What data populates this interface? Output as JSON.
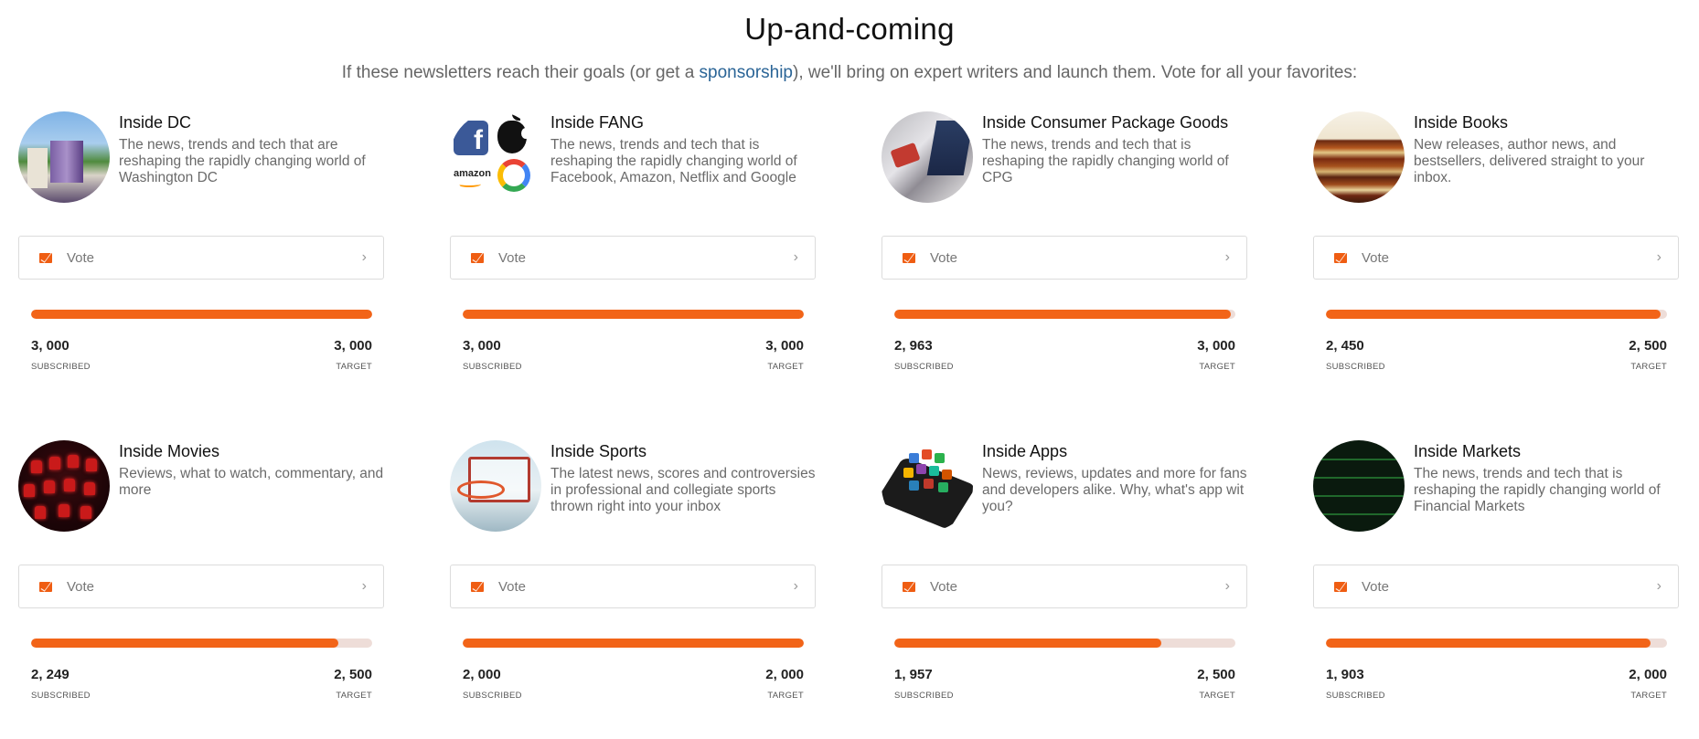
{
  "header": {
    "title": "Up-and-coming",
    "subtitle_before": "If these newsletters reach their goals (or get a ",
    "subtitle_link": "sponsorship",
    "subtitle_after": "), we'll bring on expert writers and launch them. Vote for all your favorites:"
  },
  "common": {
    "vote_label": "Vote",
    "subscribed_caption": "SUBSCRIBED",
    "target_caption": "TARGET",
    "accent_color": "#f26418",
    "link_color": "#2a6496"
  },
  "cards": [
    {
      "name": "Inside DC",
      "desc": "The news, trends and tech that are reshaping the rapidly changing world of Washington DC",
      "subscribed": "3, 000",
      "target": "3, 000",
      "progress": 1.0
    },
    {
      "name": "Inside FANG",
      "desc": "The news, trends and tech that is reshaping the rapidly changing world of Facebook, Amazon, Netflix and Google",
      "subscribed": "3, 000",
      "target": "3, 000",
      "progress": 1.0
    },
    {
      "name": "Inside Consumer Package Goods",
      "desc": "The news, trends and tech that is reshaping the rapidly changing world of CPG",
      "subscribed": "2, 963",
      "target": "3, 000",
      "progress": 0.9877
    },
    {
      "name": "Inside Books",
      "desc": "New releases, author news, and bestsellers, delivered straight to your inbox.",
      "subscribed": "2, 450",
      "target": "2, 500",
      "progress": 0.98
    },
    {
      "name": "Inside Movies",
      "desc": "Reviews, what to watch, commentary, and more",
      "subscribed": "2, 249",
      "target": "2, 500",
      "progress": 0.8996
    },
    {
      "name": "Inside Sports",
      "desc": "The latest news, scores and controversies in professional and collegiate sports thrown right into your inbox",
      "subscribed": "2, 000",
      "target": "2, 000",
      "progress": 1.0
    },
    {
      "name": "Inside Apps",
      "desc": "News, reviews, updates and more for fans and developers alike. Why, what's app wit you?",
      "subscribed": "1, 957",
      "target": "2, 500",
      "progress": 0.7828
    },
    {
      "name": "Inside Markets",
      "desc": "The news, trends and tech that is reshaping the rapidly changing world of Financial Markets",
      "subscribed": "1, 903",
      "target": "2, 000",
      "progress": 0.9515
    }
  ],
  "fang_logo_text": {
    "facebook": "f",
    "amazon": "amazon"
  }
}
